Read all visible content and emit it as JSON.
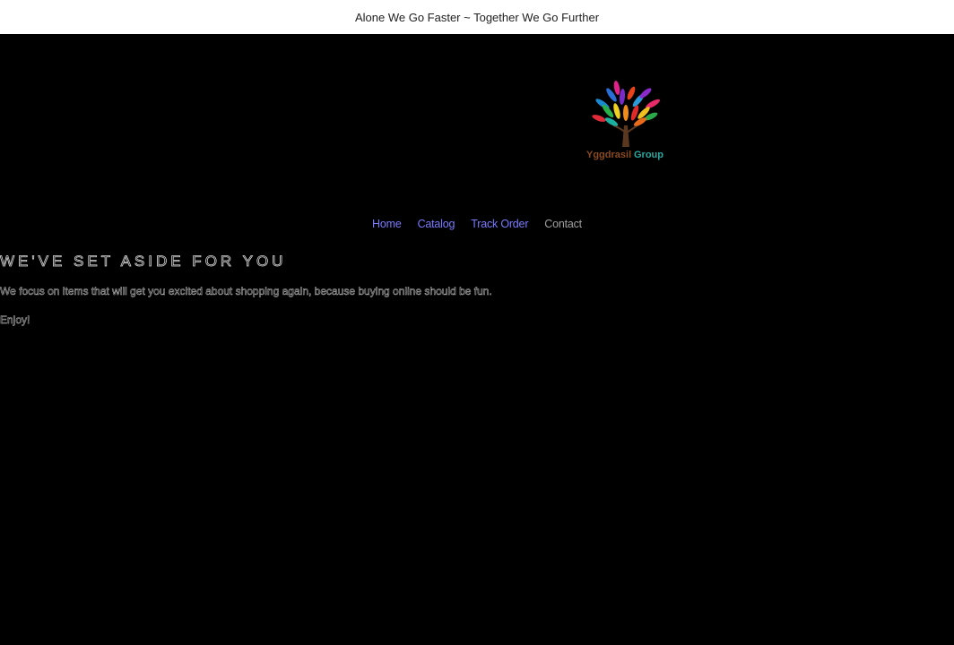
{
  "announcement": {
    "text": "Alone We Go Faster ~ Together We Go Further"
  },
  "logo": {
    "text_part1": "Yggdrasil",
    "text_part2": "Group",
    "color_part1": "#8b4a1c",
    "color_part2": "#2aa8a0"
  },
  "nav": {
    "items": [
      {
        "label": "Home"
      },
      {
        "label": "Catalog"
      },
      {
        "label": "Track Order"
      },
      {
        "label": "Contact"
      }
    ]
  },
  "main": {
    "headline": "WE'VE SET ASIDE FOR YOU",
    "paragraph1": "We focus on items that will get you excited about shopping again, because buying online should be fun.",
    "paragraph2": "Enjoy!"
  },
  "colors": {
    "background": "#000000",
    "announcement_bg": "#ffffff",
    "link": "#7a7aff",
    "current_link": "#a0a0a0"
  }
}
